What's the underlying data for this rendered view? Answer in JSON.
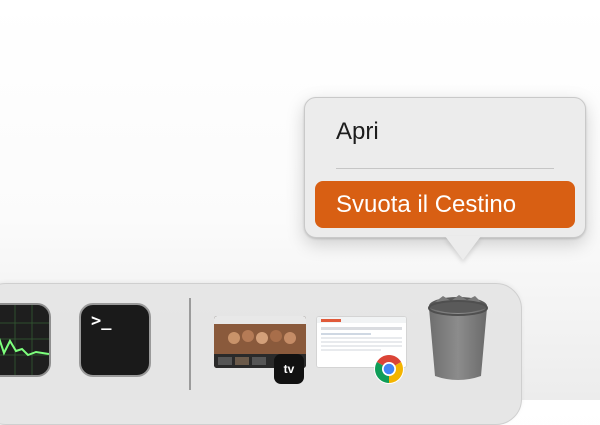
{
  "context_menu": {
    "open_label": "Apri",
    "empty_trash_label": "Svuota il Cestino"
  },
  "dock": {
    "apps": [
      {
        "name": "activity-monitor",
        "icon": "activity-monitor-icon"
      },
      {
        "name": "terminal",
        "icon": "terminal-icon",
        "prompt": ">_"
      },
      {
        "name": "apple-tv",
        "icon": "apple-tv-icon",
        "badge_label": "tv"
      },
      {
        "name": "google-chrome",
        "icon": "chrome-icon"
      },
      {
        "name": "trash",
        "icon": "trash-icon"
      }
    ]
  },
  "colors": {
    "highlight": "#d85f13",
    "menu_background": "#ececec"
  }
}
